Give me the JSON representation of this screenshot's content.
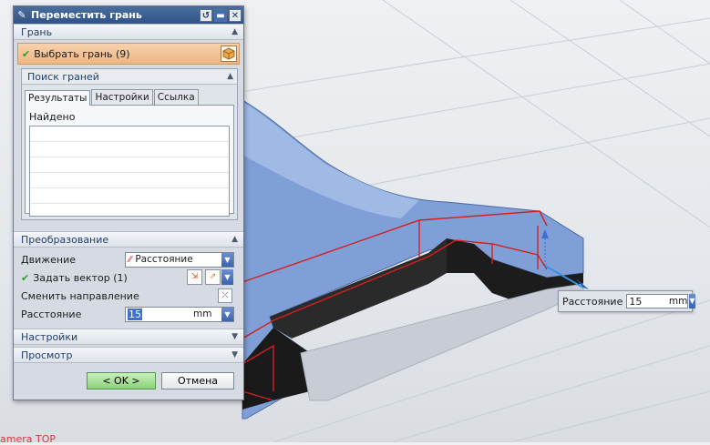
{
  "dialog": {
    "title": "Переместить грань",
    "sections": {
      "face": {
        "label": "Грань",
        "select_face_label": "Выбрать грань (9)"
      },
      "face_finder": {
        "label": "Поиск граней",
        "tabs": [
          "Результаты",
          "Настройки",
          "Ссылка"
        ],
        "found_label": "Найдено"
      },
      "transform": {
        "label": "Преобразование",
        "motion_label": "Движение",
        "motion_value": "Расстояние",
        "vector_label": "Задать вектор (1)",
        "reverse_label": "Сменить направление",
        "distance_label": "Расстояние",
        "distance_value": "15",
        "distance_unit": "mm"
      },
      "settings": {
        "label": "Настройки"
      },
      "preview": {
        "label": "Просмотр"
      }
    },
    "buttons": {
      "ok": "< OK >",
      "cancel": "Отмена"
    }
  },
  "floating_widget": {
    "label": "Расстояние",
    "value": "15",
    "unit": "mm"
  },
  "status": {
    "camera_text": "amera TOP"
  }
}
